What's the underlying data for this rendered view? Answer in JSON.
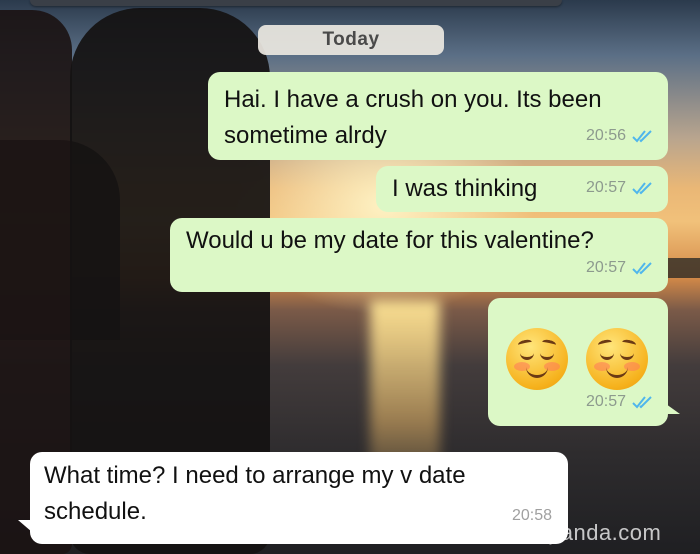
{
  "chat": {
    "date_chip": "Today",
    "messages": [
      {
        "direction": "out",
        "text": "Hai. I have a crush on you. Its been sometime alrdy",
        "time": "20:56",
        "status": "read"
      },
      {
        "direction": "out",
        "text": "I was thinking",
        "time": "20:57",
        "status": "read"
      },
      {
        "direction": "out",
        "text": "Would u be my date for this valentine?",
        "time": "20:57",
        "status": "read"
      },
      {
        "direction": "out",
        "text": "",
        "emojis": [
          "smiling-face-icon",
          "smiling-face-icon"
        ],
        "time": "20:57",
        "status": "read"
      },
      {
        "direction": "in",
        "text": "What time? I need to arrange my v date schedule.",
        "time": "20:58"
      }
    ]
  },
  "watermark": "panda.com",
  "colors": {
    "outgoing_bubble": "#dcf8c6",
    "incoming_bubble": "#ffffff",
    "read_check": "#4fb6ec"
  }
}
